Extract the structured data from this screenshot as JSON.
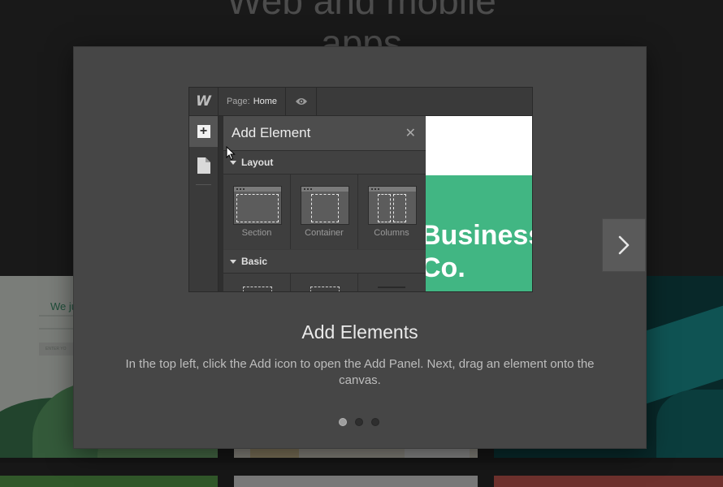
{
  "background": {
    "hero_title_line1": "Web and mobile",
    "hero_title_line2": "apps",
    "left_thumb_tagline": "We ju",
    "left_thumb_button": "ENTER YO"
  },
  "modal": {
    "title": "Add Elements",
    "body": "In the top left, click the Add icon to open the Add Panel. Next, drag an element onto the canvas.",
    "next_icon": "chevron-right-icon",
    "pagination": {
      "total": 3,
      "active": 1
    }
  },
  "screenshot": {
    "logo": "W",
    "page_label": "Page:",
    "page_value": "Home",
    "panel_title": "Add Element",
    "close_symbol": "✕",
    "sections": [
      {
        "label": "Layout",
        "items": [
          "Section",
          "Container",
          "Columns"
        ]
      },
      {
        "label": "Basic"
      }
    ],
    "canvas_text": "Business\nCo."
  },
  "colors": {
    "modal_bg": "#464646",
    "canvas_green": "#41b683",
    "overlay": "rgba(0,0,0,0.45)"
  }
}
